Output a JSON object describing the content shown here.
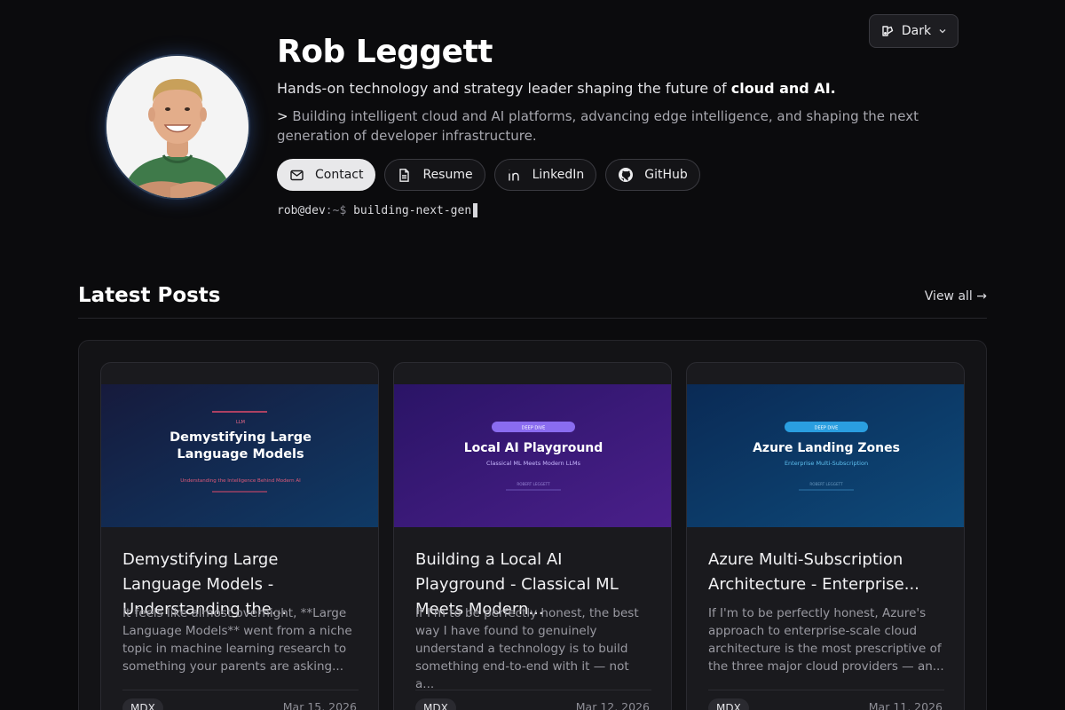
{
  "theme_toggle": {
    "label": "Dark",
    "icon": "theme-icon"
  },
  "profile": {
    "name": "Rob Leggett",
    "tagline_prefix": "Hands-on technology and strategy leader shaping the future of ",
    "tagline_bold": "cloud and AI.",
    "intro_marker": ">",
    "intro": "Building intelligent cloud and AI platforms, advancing edge intelligence, and shaping the next generation of developer infrastructure."
  },
  "actions": [
    {
      "label": "Contact",
      "icon": "mail-icon"
    },
    {
      "label": "Resume",
      "icon": "document-icon"
    },
    {
      "label": "LinkedIn",
      "icon": "linkedin-icon"
    },
    {
      "label": "GitHub",
      "icon": "github-icon"
    }
  ],
  "terminal": {
    "user": "rob@dev",
    "path": ":~$",
    "command": "building-next-gen"
  },
  "posts_section": {
    "title": "Latest Posts",
    "view_all": "View all →"
  },
  "posts": [
    {
      "image": {
        "badge": "LLM",
        "heading_line1": "Demystifying Large",
        "heading_line2": "Language Models",
        "subheading": "Understanding the Intelligence Behind Modern AI",
        "author": ""
      },
      "title": "Demystifying Large Language Models - Understanding the...",
      "excerpt": "It feels like almost overnight, **Large Language Models** went from a niche topic in machine learning research to something your parents are asking...",
      "tag": "MDX",
      "date": "Mar 15, 2026"
    },
    {
      "image": {
        "badge": "DEEP DIVE",
        "heading_line1": "Local AI Playground",
        "heading_line2": "",
        "subheading": "Classical ML Meets Modern LLMs",
        "author": "ROBERT LEGGETT"
      },
      "title": "Building a Local AI Playground - Classical ML Meets Modern...",
      "excerpt": "If I'm to be perfectly honest, the best way I have found to genuinely understand a technology is to build something end-to-end with it — not a...",
      "tag": "MDX",
      "date": "Mar 12, 2026"
    },
    {
      "image": {
        "badge": "DEEP DIVE",
        "heading_line1": "Azure Landing Zones",
        "heading_line2": "",
        "subheading": "Enterprise Multi-Subscription",
        "author": "ROBERT LEGGETT"
      },
      "title": "Azure Multi-Subscription Architecture - Enterprise...",
      "excerpt": "If I'm to be perfectly honest, Azure's approach to enterprise-scale cloud architecture is the most prescriptive of the three major cloud providers — an...",
      "tag": "MDX",
      "date": "Mar 11, 2026"
    }
  ]
}
